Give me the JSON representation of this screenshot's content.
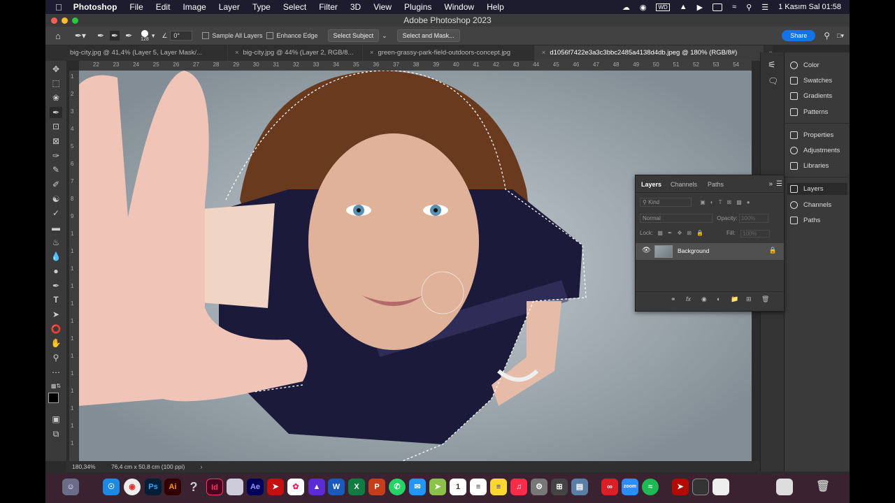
{
  "menubar": {
    "app": "Photoshop",
    "items": [
      "File",
      "Edit",
      "Image",
      "Layer",
      "Type",
      "Select",
      "Filter",
      "3D",
      "View",
      "Plugins",
      "Window",
      "Help"
    ],
    "datetime": "1 Kasım Sal  01:58"
  },
  "window": {
    "title": "Adobe Photoshop 2023"
  },
  "options": {
    "brush_size": "128",
    "angle": "0°",
    "sample_all_layers": "Sample All Layers",
    "enhance_edge": "Enhance Edge",
    "select_subject": "Select Subject",
    "select_and_mask": "Select and Mask...",
    "share": "Share"
  },
  "tabs": [
    {
      "label": "big-city.jpg @ 41,4% (Layer 5, Layer Mask/..."
    },
    {
      "label": "big-city.jpg @ 44% (Layer 2, RGB/8..."
    },
    {
      "label": "green-grassy-park-field-outdoors-concept.jpg"
    },
    {
      "label": "d1056f7422e3a3c3bbc2485a4138d4db.jpeg @ 180% (RGB/8#)"
    }
  ],
  "ruler_top": [
    "22",
    "23",
    "24",
    "25",
    "26",
    "27",
    "28",
    "29",
    "30",
    "31",
    "32",
    "33",
    "34",
    "35",
    "36",
    "37",
    "38",
    "39",
    "40",
    "41",
    "42",
    "43",
    "44",
    "45",
    "46",
    "47",
    "48",
    "49",
    "50",
    "51",
    "52",
    "53",
    "54"
  ],
  "ruler_left": [
    "1",
    "2",
    "3",
    "4",
    "5",
    "6",
    "7",
    "8",
    "9",
    "1",
    "1",
    "1",
    "1",
    "1",
    "1",
    "1",
    "1",
    "1",
    "1",
    "1",
    "1",
    "1"
  ],
  "status": {
    "zoom": "180,34%",
    "doc_size": "76,4 cm x 50,8 cm (100 ppi)"
  },
  "right_panels": {
    "group1": [
      "Color",
      "Swatches",
      "Gradients",
      "Patterns"
    ],
    "group2": [
      "Properties",
      "Adjustments",
      "Libraries"
    ],
    "group3": [
      "Layers",
      "Channels",
      "Paths"
    ]
  },
  "layers_panel": {
    "tabs": [
      "Layers",
      "Channels",
      "Paths"
    ],
    "kind": "Kind",
    "blend_mode": "Normal",
    "opacity_label": "Opacity:",
    "opacity_value": "100%",
    "lock_label": "Lock:",
    "fill_label": "Fill:",
    "fill_value": "100%",
    "layer_name": "Background"
  },
  "colors": {
    "accent": "#1473e6",
    "panel": "#383838",
    "canvas_bg": "#2b2b2b"
  }
}
